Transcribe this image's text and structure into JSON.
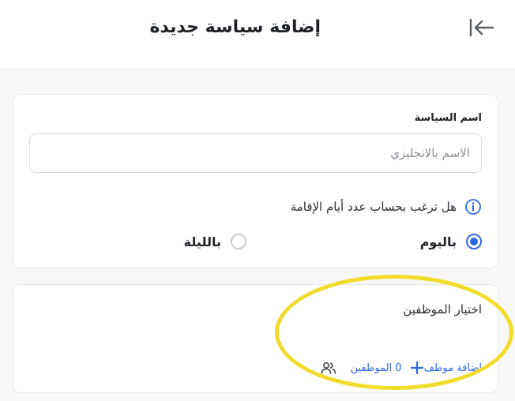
{
  "header": {
    "title": "إضافة سياسة جديدة",
    "back_icon": "arrow-left-bar-icon"
  },
  "policy": {
    "name_label": "اسم السياسة",
    "name_placeholder": "الاسم بالانجليزي",
    "name_value": "",
    "question": "هل ترغب بحساب عدد أيام الإقامة",
    "info_icon": "info-icon",
    "options": [
      {
        "label": "باليوم",
        "selected": true
      },
      {
        "label": "بالليلة",
        "selected": false
      }
    ]
  },
  "employees": {
    "title": "اختيار الموظفين",
    "count_text": "0 الموظفين",
    "add_label": "اضافة موظف",
    "users_icon": "users-icon",
    "plus_icon": "plus-icon"
  },
  "colors": {
    "accent": "#2f66e6",
    "highlight": "#f2dc2a"
  }
}
